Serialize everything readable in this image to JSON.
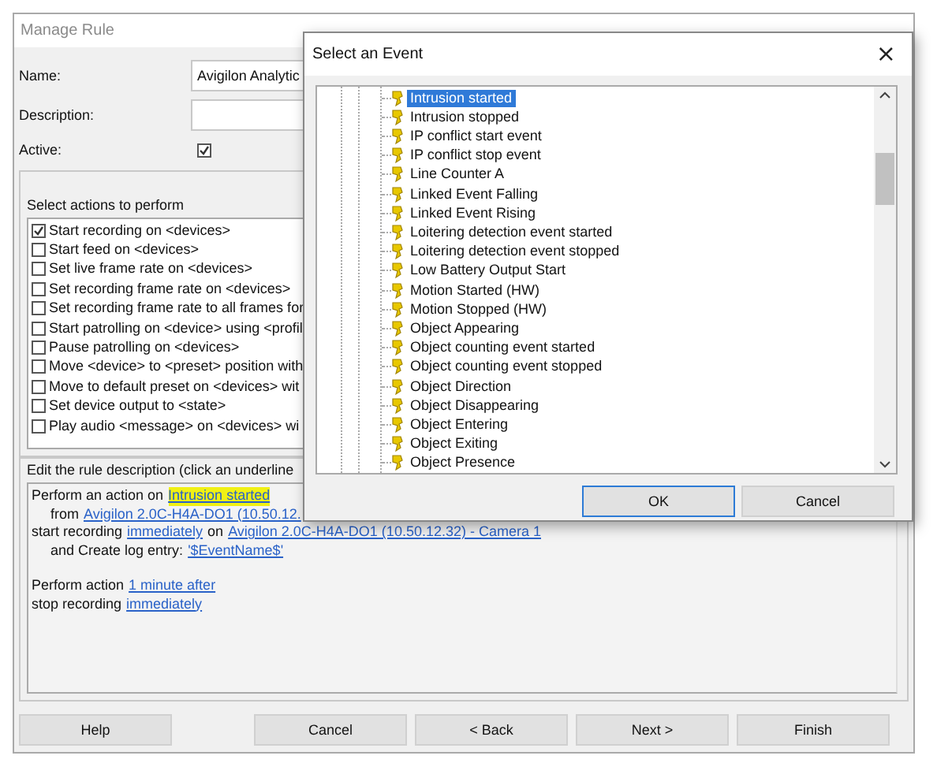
{
  "window": {
    "title": "Manage Rule"
  },
  "form": {
    "name_label": "Name:",
    "name_value": "Avigilon Analytic",
    "description_label": "Description:",
    "active_label": "Active:",
    "active_checked": true
  },
  "actions": {
    "title": "Select actions to perform",
    "items": [
      {
        "label": "Start recording on <devices>",
        "checked": true
      },
      {
        "label": "Start feed on <devices>",
        "checked": false
      },
      {
        "label": "Set live frame rate on <devices>",
        "checked": false
      },
      {
        "label": "Set recording frame rate on <devices>",
        "checked": false
      },
      {
        "label": "Set recording frame rate to all frames for",
        "checked": false
      },
      {
        "label": "Start patrolling on <device> using <profil",
        "checked": false
      },
      {
        "label": "Pause patrolling on <devices>",
        "checked": false
      },
      {
        "label": "Move <device> to <preset> position with",
        "checked": false
      },
      {
        "label": "Move to default preset on <devices> wit",
        "checked": false
      },
      {
        "label": "Set device output to <state>",
        "checked": false
      },
      {
        "label": "Play audio <message> on <devices> wi",
        "checked": false
      }
    ]
  },
  "description": {
    "title": "Edit the rule description (click an underline",
    "paragraphs": [
      {
        "lines": [
          {
            "kind": "main",
            "parts": [
              {
                "kind": "plain",
                "text": "Perform an action on"
              },
              {
                "kind": "highlight",
                "text": "Intrusion started"
              }
            ]
          },
          {
            "kind": "sub",
            "parts": [
              {
                "kind": "plain",
                "text": "from"
              },
              {
                "kind": "link",
                "text": "Avigilon 2.0C-H4A-DO1 (10.50.12."
              }
            ]
          },
          {
            "kind": "main",
            "parts": [
              {
                "kind": "plain",
                "text": "start recording"
              },
              {
                "kind": "link",
                "text": "immediately"
              },
              {
                "kind": "plain",
                "text": "on"
              },
              {
                "kind": "link",
                "text": "Avigilon 2.0C-H4A-DO1 (10.50.12.32) - Camera 1"
              }
            ]
          },
          {
            "kind": "sub",
            "parts": [
              {
                "kind": "plain",
                "text": "and Create log entry:"
              },
              {
                "kind": "link",
                "text": "'$EventName$'"
              }
            ]
          }
        ]
      },
      {
        "lines": [
          {
            "kind": "main",
            "parts": [
              {
                "kind": "plain",
                "text": "Perform action"
              },
              {
                "kind": "link",
                "text": "1 minute after"
              }
            ]
          },
          {
            "kind": "main",
            "parts": [
              {
                "kind": "plain",
                "text": "stop recording"
              },
              {
                "kind": "link",
                "text": "immediately"
              }
            ]
          }
        ]
      }
    ]
  },
  "buttons": [
    {
      "label": "Help",
      "kind": "left"
    },
    {
      "label": "Cancel",
      "kind": "right"
    },
    {
      "label": "< Back",
      "kind": "right"
    },
    {
      "label": "Next >",
      "kind": "right"
    },
    {
      "label": "Finish",
      "kind": "right"
    }
  ],
  "event_dialog": {
    "title": "Select an Event",
    "close": "×",
    "events": [
      {
        "label": "Intrusion started",
        "selected": true
      },
      {
        "label": "Intrusion stopped",
        "selected": false
      },
      {
        "label": "IP conflict start event",
        "selected": false
      },
      {
        "label": "IP conflict stop event",
        "selected": false
      },
      {
        "label": "Line Counter A",
        "selected": false
      },
      {
        "label": "Linked Event Falling",
        "selected": false
      },
      {
        "label": "Linked Event Rising",
        "selected": false
      },
      {
        "label": "Loitering detection event started",
        "selected": false
      },
      {
        "label": "Loitering detection event stopped",
        "selected": false
      },
      {
        "label": "Low Battery Output Start",
        "selected": false
      },
      {
        "label": "Motion Started (HW)",
        "selected": false
      },
      {
        "label": "Motion Stopped (HW)",
        "selected": false
      },
      {
        "label": "Object Appearing",
        "selected": false
      },
      {
        "label": "Object counting event started",
        "selected": false
      },
      {
        "label": "Object counting event stopped",
        "selected": false
      },
      {
        "label": "Object Direction",
        "selected": false
      },
      {
        "label": "Object Disappearing",
        "selected": false
      },
      {
        "label": "Object Entering",
        "selected": false
      },
      {
        "label": "Object Exiting",
        "selected": false
      },
      {
        "label": "Object Presence",
        "selected": false
      }
    ],
    "buttons": [
      {
        "label": "OK",
        "kind": "default"
      },
      {
        "label": "Cancel",
        "kind": "normal"
      }
    ]
  }
}
